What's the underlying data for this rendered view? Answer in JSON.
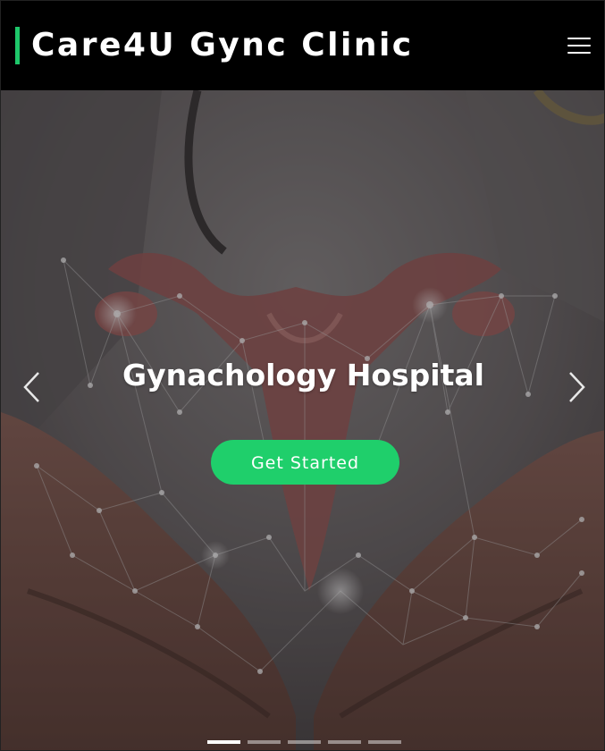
{
  "header": {
    "brand_title": "Care4U Gync Clinic",
    "brand_accent_color": "#1ec76a",
    "menu_icon": "hamburger-menu-icon"
  },
  "hero": {
    "title": "Gynachology Hospital",
    "cta_label": "Get Started",
    "cta_color": "#1fcf6b",
    "prev_icon": "chevron-left-icon",
    "next_icon": "chevron-right-icon",
    "background_description_icon": "uterus-network-hands-image",
    "carousel": {
      "slide_count": 5,
      "active_index": 0
    }
  }
}
